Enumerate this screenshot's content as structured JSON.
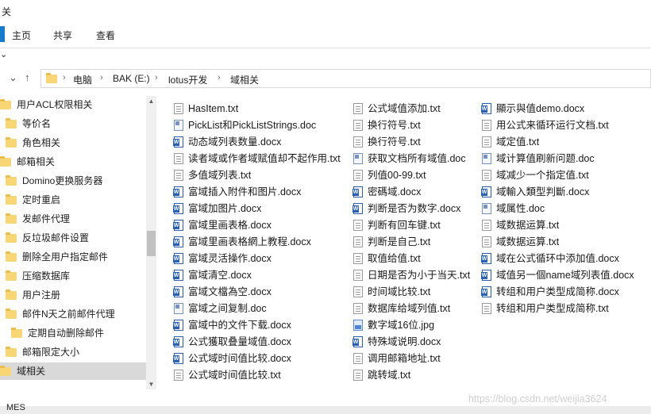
{
  "window": {
    "title": "关"
  },
  "ribbon": {
    "tabs": [
      "主页",
      "共享",
      "查看"
    ]
  },
  "address": {
    "crumbs": [
      "电脑",
      "BAK (E:)",
      "lotus开发",
      "域相关"
    ]
  },
  "sidebar": {
    "items": [
      {
        "label": "用户ACL权限相关",
        "indent": 0
      },
      {
        "label": "等价名",
        "indent": 1
      },
      {
        "label": "角色相关",
        "indent": 1
      },
      {
        "label": "邮箱相关",
        "indent": 0
      },
      {
        "label": "Domino更换服务器",
        "indent": 1
      },
      {
        "label": "定时重启",
        "indent": 1
      },
      {
        "label": "发邮件代理",
        "indent": 1
      },
      {
        "label": "反垃圾邮件设置",
        "indent": 1
      },
      {
        "label": "删除全用户指定邮件",
        "indent": 1
      },
      {
        "label": "压缩数据库",
        "indent": 1
      },
      {
        "label": "用户注册",
        "indent": 1
      },
      {
        "label": "邮件N天之前邮件代理",
        "indent": 1
      },
      {
        "label": "定期自动删除邮件",
        "indent": 2
      },
      {
        "label": "邮箱限定大小",
        "indent": 1
      },
      {
        "label": "域相关",
        "indent": 0,
        "selected": true
      }
    ],
    "partial_item": "MES"
  },
  "files": {
    "col1": [
      {
        "name": "HasItem.txt",
        "type": "txt"
      },
      {
        "name": "PickList和PickListStrings.doc",
        "type": "tmpl"
      },
      {
        "name": "动态域列表数量.docx",
        "type": "doc"
      },
      {
        "name": "读者域或作者域赋值却不起作用.txt",
        "type": "txt"
      },
      {
        "name": "多值域列表.txt",
        "type": "txt"
      },
      {
        "name": "富域插入附件和图片.docx",
        "type": "doc"
      },
      {
        "name": "富域加图片.docx",
        "type": "doc"
      },
      {
        "name": "富域里画表格.docx",
        "type": "doc"
      },
      {
        "name": "富域里画表格網上教程.docx",
        "type": "doc"
      },
      {
        "name": "富域灵活操作.docx",
        "type": "doc"
      },
      {
        "name": "富域清空.docx",
        "type": "doc"
      },
      {
        "name": "富域文檔為空.docx",
        "type": "doc"
      },
      {
        "name": "富域之间复制.doc",
        "type": "tmpl"
      },
      {
        "name": "富域中的文件下载.docx",
        "type": "doc"
      },
      {
        "name": "公式獲取叠量域值.docx",
        "type": "doc"
      },
      {
        "name": "公式域时间值比较.docx",
        "type": "doc"
      },
      {
        "name": "公式域时间值比较.txt",
        "type": "txt"
      }
    ],
    "col2": [
      {
        "name": "公式域值添加.txt",
        "type": "txt"
      },
      {
        "name": "换行符号.txt",
        "type": "txt"
      },
      {
        "name": "换行符号.txt",
        "type": "txt"
      },
      {
        "name": "获取文档所有域值.doc",
        "type": "tmpl"
      },
      {
        "name": "列值00-99.txt",
        "type": "txt"
      },
      {
        "name": "密碼域.docx",
        "type": "doc"
      },
      {
        "name": "判断是否为数字.docx",
        "type": "doc"
      },
      {
        "name": "判断有回车键.txt",
        "type": "txt"
      },
      {
        "name": "判断是自己.txt",
        "type": "txt"
      },
      {
        "name": "取值给值.txt",
        "type": "txt"
      },
      {
        "name": "日期是否为小于当天.txt",
        "type": "txt"
      },
      {
        "name": "时间域比较.txt",
        "type": "txt"
      },
      {
        "name": "数据库给域列值.txt",
        "type": "txt"
      },
      {
        "name": "數字域16位.jpg",
        "type": "jpg"
      },
      {
        "name": "特殊域说明.docx",
        "type": "doc"
      },
      {
        "name": "调用邮箱地址.txt",
        "type": "txt"
      },
      {
        "name": "跳转域.txt",
        "type": "txt"
      }
    ],
    "col3": [
      {
        "name": "顯示與值demo.docx",
        "type": "doc"
      },
      {
        "name": "用公式来循环运行文档.txt",
        "type": "txt"
      },
      {
        "name": "域定值.txt",
        "type": "txt"
      },
      {
        "name": "域计算值刷新问题.doc",
        "type": "tmpl"
      },
      {
        "name": "域减少一个指定值.txt",
        "type": "txt"
      },
      {
        "name": "域輸入類型判斷.docx",
        "type": "doc"
      },
      {
        "name": "域属性.doc",
        "type": "tmpl"
      },
      {
        "name": "域数据运算.txt",
        "type": "txt"
      },
      {
        "name": "域数据运算.txt",
        "type": "txt"
      },
      {
        "name": "域在公式循环中添加值.docx",
        "type": "doc"
      },
      {
        "name": "域值另一個name域列表值.docx",
        "type": "doc"
      },
      {
        "name": "转组和用户类型成简称.docx",
        "type": "doc"
      },
      {
        "name": "转组和用户类型成简称.txt",
        "type": "txt"
      }
    ]
  },
  "watermark": "https://blog.csdn.net/weijia3624"
}
